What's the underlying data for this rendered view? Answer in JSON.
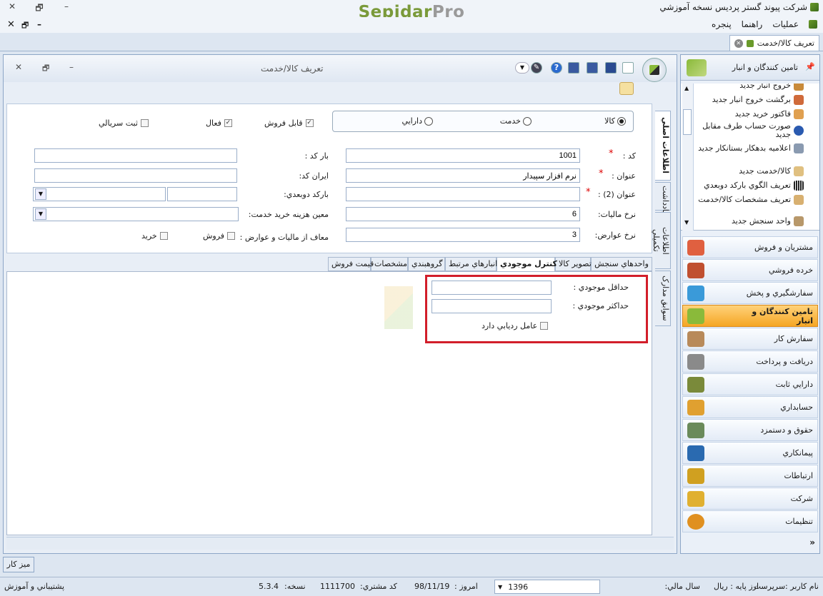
{
  "app": {
    "logo_left": "Sepidar",
    "logo_right": "Pro",
    "company_title": "شرکت پیوند گستر پردیس نسخه آموزشي"
  },
  "menu": [
    "عمليات",
    "راهنما",
    "پنجره"
  ],
  "doc_tab": "تعريف کالا/خدمت",
  "window": {
    "title": "تعريف کالا/خدمت"
  },
  "form": {
    "radios": [
      {
        "label": "کالا",
        "selected": true
      },
      {
        "label": "خدمت",
        "selected": false
      },
      {
        "label": "دارايي",
        "selected": false
      }
    ],
    "checkboxes": [
      {
        "label": "قابل فروش",
        "checked": true
      },
      {
        "label": "فعال",
        "checked": true
      },
      {
        "label": "ثبت سريالي",
        "checked": false
      }
    ],
    "code_label": "کد :",
    "code_value": "1001",
    "title_label": "عنوان :",
    "title_value": "نرم افزار سپيدار",
    "title2_label": "عنوان (2) :",
    "title2_value": "",
    "tax_label": "نرخ ماليات:",
    "tax_value": "6",
    "duty_label": "نرخ عوارض:",
    "duty_value": "3",
    "barcode_label": "بار کد :",
    "irancode_label": "ايران کد:",
    "dual_barcode_label": "بارکد دوبعدي:",
    "service_cost_label": "معين هزينه خريد خدمت:",
    "exempt_label": "معاف از ماليات و عوارض :",
    "exempt_options": [
      {
        "label": "فروش",
        "checked": false
      },
      {
        "label": "خريد",
        "checked": false
      }
    ]
  },
  "side_tabs": [
    "اطلاعات اصلي",
    "يادداشت",
    "اطلاعات تکميلي",
    "سوابق مدارک"
  ],
  "subtabs": [
    {
      "label": "واحدهاي سنجش",
      "active": false
    },
    {
      "label": "تصوير کالا",
      "active": false
    },
    {
      "label": "کنترل موجودي",
      "active": true
    },
    {
      "label": "انبارهاي مرتبط",
      "active": false
    },
    {
      "label": "گروهبندي",
      "active": false
    },
    {
      "label": "مشخصات",
      "active": false
    },
    {
      "label": "قيمت فروش",
      "active": false
    }
  ],
  "inventory": {
    "min_label": "حداقل موجودي :",
    "min_value": "",
    "max_label": "حداکثر موجودي :",
    "max_value": "",
    "tracking_label": "عامل رديابي دارد",
    "tracking_checked": false
  },
  "nav": {
    "header": "تامين کنندگان و انبار",
    "list": [
      "خروج انبار جديد",
      "برگشت خروج انبار جديد",
      "فاکتور خريد جديد",
      "صورت حساب طرف مقابل جديد",
      "اعلاميه بدهکار بستانکار جديد",
      "کالا/خدمت جديد",
      "تعريف الگوي بارکد دوبعدي",
      "تعريف مشخصات کالا/خدمت",
      "واحد سنجش جديد"
    ],
    "sections": [
      {
        "label": "مشتريان و فروش",
        "color": "#e06040",
        "active": false
      },
      {
        "label": "خرده فروشي",
        "color": "#c05030",
        "active": false
      },
      {
        "label": "سفارشگيري و پخش",
        "color": "#3a9ad9",
        "active": false
      },
      {
        "label": "تامين کنندگان و انبار",
        "color": "#8aba3a",
        "active": true
      },
      {
        "label": "سفارش کار",
        "color": "#b88a5a",
        "active": false
      },
      {
        "label": "دريافت و پرداخت",
        "color": "#8a8a8a",
        "active": false
      },
      {
        "label": "دارايي ثابت",
        "color": "#7a8a3a",
        "active": false
      },
      {
        "label": "حسابداري",
        "color": "#e0a030",
        "active": false
      },
      {
        "label": "حقوق و دستمزد",
        "color": "#6a8a5a",
        "active": false
      },
      {
        "label": "پيمانکاري",
        "color": "#2a6ab0",
        "active": false
      },
      {
        "label": "ارتباطات",
        "color": "#d0a020",
        "active": false
      },
      {
        "label": "شرکت",
        "color": "#e0b030",
        "active": false
      },
      {
        "label": "تنظيمات",
        "color": "#e09020",
        "active": false
      }
    ]
  },
  "desk_button": "ميز کار",
  "status": {
    "username": "نام کاربر :سرپرست",
    "base_currency": "ارز پايه :  ريال",
    "fiscal_year_label": "سال مالي:",
    "fiscal_year": "1396",
    "today_label": "امروز :",
    "today": "98/11/19",
    "customer_code_label": "کد مشتري:",
    "customer_code": "1111700",
    "version_label": "نسخه:",
    "version": "5.3.4",
    "support": "پشتيباني و آموزش"
  }
}
